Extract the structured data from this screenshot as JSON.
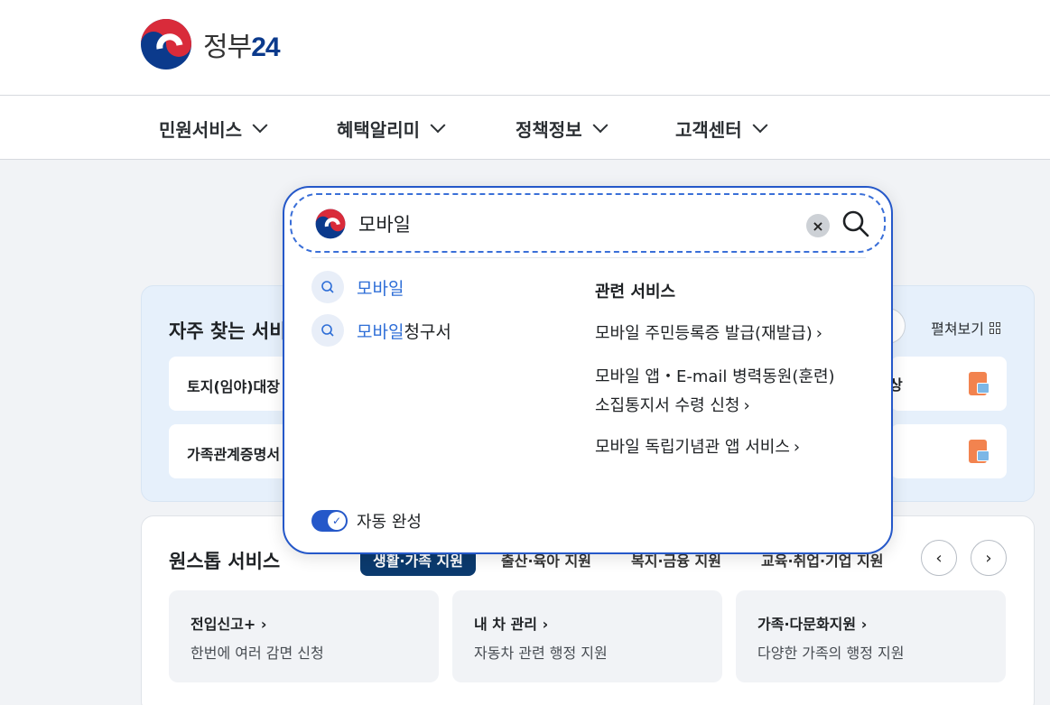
{
  "header": {
    "logo_text": "정부",
    "logo_num": "24",
    "nav": [
      "민원서비스",
      "혜택알리미",
      "정책정보",
      "고객센터"
    ]
  },
  "frequent": {
    "title": "자주 찾는 서비",
    "expand_label": "펼쳐보기",
    "cards": [
      "토지(임야)대장",
      "가족관계증명서"
    ],
    "right_fragment": "상"
  },
  "onestop": {
    "title": "원스톱 서비스",
    "tabs": [
      "생활·가족 지원",
      "출산·육아 지원",
      "복지·금융 지원",
      "교육·취업·기업 지원"
    ],
    "prev": "‹",
    "next": "›",
    "cards": [
      {
        "title": "전입신고+",
        "desc": "한번에 여러 감면 신청"
      },
      {
        "title": "내 차 관리",
        "desc": "자동차 관련 행정 지원"
      },
      {
        "title": "가족·다문화지원",
        "desc": "다양한 가족의 행정 지원"
      }
    ]
  },
  "search": {
    "value": "모바일",
    "clear": "×",
    "suggestions": [
      {
        "highlight": "모바일",
        "rest": ""
      },
      {
        "highlight": "모바일",
        "rest": "청구서"
      }
    ],
    "related_title": "관련 서비스",
    "related": [
      "모바일 주민등록증 발급(재발급)",
      "모바일 앱・E-mail 병력동원(훈련)",
      "소집통지서 수령 신청",
      "모바일 독립기념관 앱 서비스"
    ],
    "autocomplete_label": "자동 완성",
    "autocomplete_on": true
  },
  "colors": {
    "accent": "#2558c9",
    "tab_active": "#0b3a6e",
    "highlight": "#2e6ed7"
  }
}
